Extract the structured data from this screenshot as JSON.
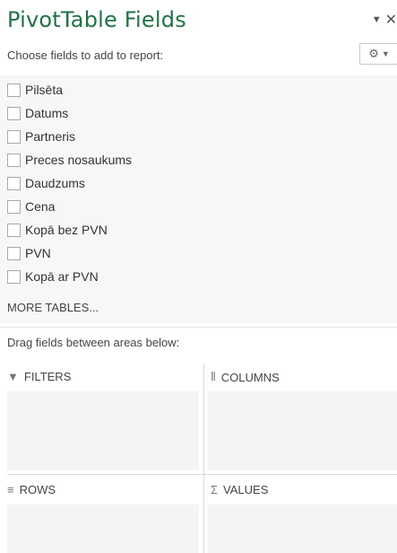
{
  "panel": {
    "title": "PivotTable Fields",
    "dropdown_icon": "▼",
    "close_icon": "✕",
    "subtitle": "Choose fields to add to report:",
    "tools_icon": "⚙",
    "tools_caret": "▼"
  },
  "fields": [
    {
      "label": "Pilsēta",
      "checked": false
    },
    {
      "label": "Datums",
      "checked": false
    },
    {
      "label": "Partneris",
      "checked": false
    },
    {
      "label": "Preces nosaukums",
      "checked": false
    },
    {
      "label": "Daudzums",
      "checked": false
    },
    {
      "label": "Cena",
      "checked": false
    },
    {
      "label": "Kopā bez PVN",
      "checked": false
    },
    {
      "label": "PVN",
      "checked": false
    },
    {
      "label": "Kopā ar PVN",
      "checked": false
    }
  ],
  "more_tables": "MORE TABLES...",
  "drag_hint": "Drag fields between areas below:",
  "areas": {
    "filters": {
      "label": "FILTERS",
      "icon": "▼"
    },
    "columns": {
      "label": "COLUMNS",
      "icon": "⦀"
    },
    "rows": {
      "label": "ROWS",
      "icon": "≡"
    },
    "values": {
      "label": "VALUES",
      "icon": "Σ"
    }
  }
}
